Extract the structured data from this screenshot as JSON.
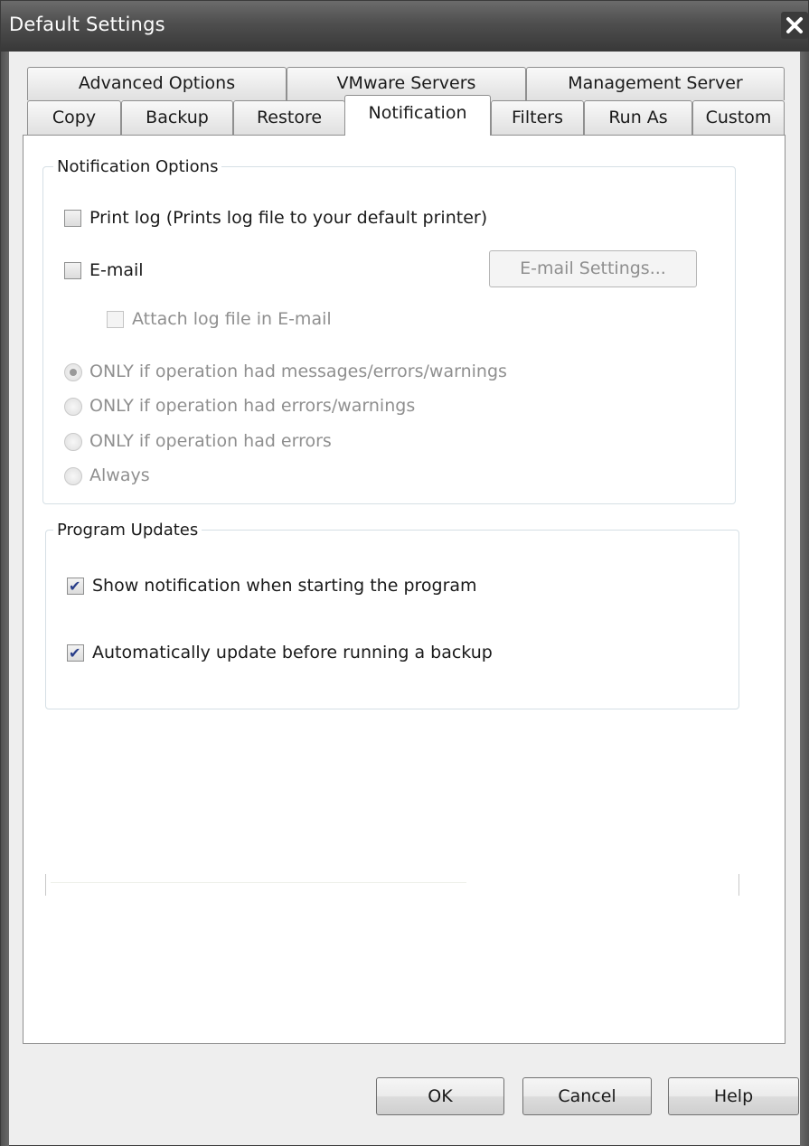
{
  "window": {
    "title": "Default Settings"
  },
  "tabs": {
    "row1": [
      "Advanced Options",
      "VMware Servers",
      "Management Server"
    ],
    "row2": [
      "Copy",
      "Backup",
      "Restore",
      "Notification",
      "Filters",
      "Run As",
      "Custom"
    ],
    "active": "Notification"
  },
  "notification_options": {
    "title": "Notification Options",
    "print_log": {
      "label": "Print log (Prints log file to your default printer)",
      "checked": false
    },
    "email": {
      "label": "E-mail",
      "checked": false
    },
    "email_settings_button": "E-mail Settings...",
    "attach_log": {
      "label": "Attach log file in E-mail",
      "checked": false,
      "enabled": false
    },
    "radios": [
      {
        "label": "ONLY if operation had messages/errors/warnings",
        "selected": true
      },
      {
        "label": "ONLY if operation had errors/warnings",
        "selected": false
      },
      {
        "label": "ONLY if operation had errors",
        "selected": false
      },
      {
        "label": "Always",
        "selected": false
      }
    ]
  },
  "program_updates": {
    "title": "Program Updates",
    "show_notification": {
      "label": "Show notification when starting the program",
      "checked": true
    },
    "auto_update": {
      "label": "Automatically update before running a backup",
      "checked": true
    }
  },
  "buttons": {
    "ok": "OK",
    "cancel": "Cancel",
    "help": "Help"
  },
  "colors": {
    "titlebar": "#4e4e4e",
    "check_mark": "#2a3f8a",
    "disabled_text": "#8f8f8f"
  }
}
